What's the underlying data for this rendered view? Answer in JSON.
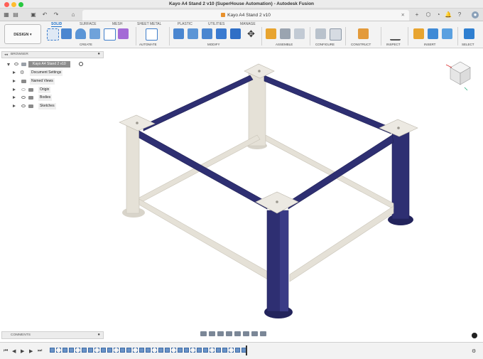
{
  "window": {
    "title": "Kayo A4 Stand 2 v10 (SuperHouse Automation) - Autodesk Fusion",
    "doc_tab": "Kayo A4 Stand 2 v10"
  },
  "ribbon": {
    "workspace": "DESIGN",
    "tabs": [
      {
        "label": "SOLID",
        "active": true
      },
      {
        "label": "SURFACE",
        "active": false
      },
      {
        "label": "MESH",
        "active": false
      },
      {
        "label": "SHEET METAL",
        "active": false
      },
      {
        "label": "PLASTIC",
        "active": false
      },
      {
        "label": "UTILITIES",
        "active": false
      },
      {
        "label": "MANAGE",
        "active": false
      }
    ],
    "groups": [
      "CREATE",
      "AUTOMATE",
      "MODIFY",
      "ASSEMBLE",
      "CONFIGURE",
      "CONSTRUCT",
      "INSPECT",
      "INSERT",
      "SELECT"
    ]
  },
  "browser": {
    "title": "BROWSER",
    "root": "Kayo A4 Stand 2 v10",
    "items": [
      "Document Settings",
      "Named Views",
      "Origin",
      "Bodies",
      "Sketches"
    ]
  },
  "comments": {
    "label": "COMMENTS"
  },
  "colors": {
    "accent": "#1a6fc9",
    "frame_navy": "#2e2f72",
    "frame_cream": "#e5e1d7"
  }
}
